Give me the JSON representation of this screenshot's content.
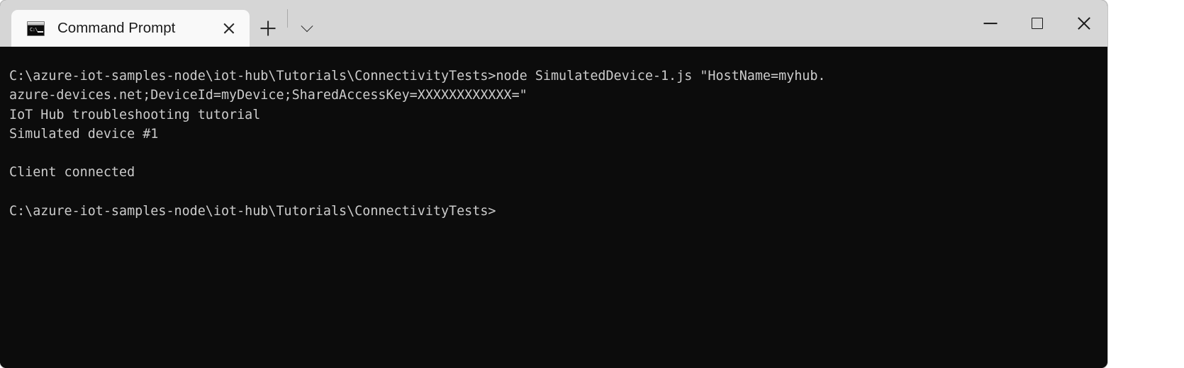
{
  "window": {
    "tab": {
      "title": "Command Prompt",
      "icon": "command-prompt-icon",
      "icon_prompt_text": "C:\\",
      "close_icon": "close-icon"
    },
    "new_tab_icon": "plus-icon",
    "tab_dropdown_icon": "chevron-down-icon",
    "controls": {
      "minimize": "minimize-icon",
      "maximize": "maximize-icon",
      "close": "close-icon"
    },
    "colors": {
      "titlebar": "#d6d6d6",
      "active_tab": "#f9f9f9",
      "terminal_background": "#0c0c0c",
      "terminal_foreground": "#cccccc"
    }
  },
  "terminal": {
    "lines": [
      "C:\\azure-iot-samples-node\\iot-hub\\Tutorials\\ConnectivityTests>node SimulatedDevice-1.js \"HostName=myhub.",
      "azure-devices.net;DeviceId=myDevice;SharedAccessKey=XXXXXXXXXXXX=\"",
      "IoT Hub troubleshooting tutorial",
      "Simulated device #1",
      "",
      "Client connected",
      "",
      "C:\\azure-iot-samples-node\\iot-hub\\Tutorials\\ConnectivityTests>"
    ],
    "content": "C:\\azure-iot-samples-node\\iot-hub\\Tutorials\\ConnectivityTests>node SimulatedDevice-1.js \"HostName=myhub.\nazure-devices.net;DeviceId=myDevice;SharedAccessKey=XXXXXXXXXXXX=\"\nIoT Hub troubleshooting tutorial\nSimulated device #1\n\nClient connected\n\nC:\\azure-iot-samples-node\\iot-hub\\Tutorials\\ConnectivityTests>"
  }
}
